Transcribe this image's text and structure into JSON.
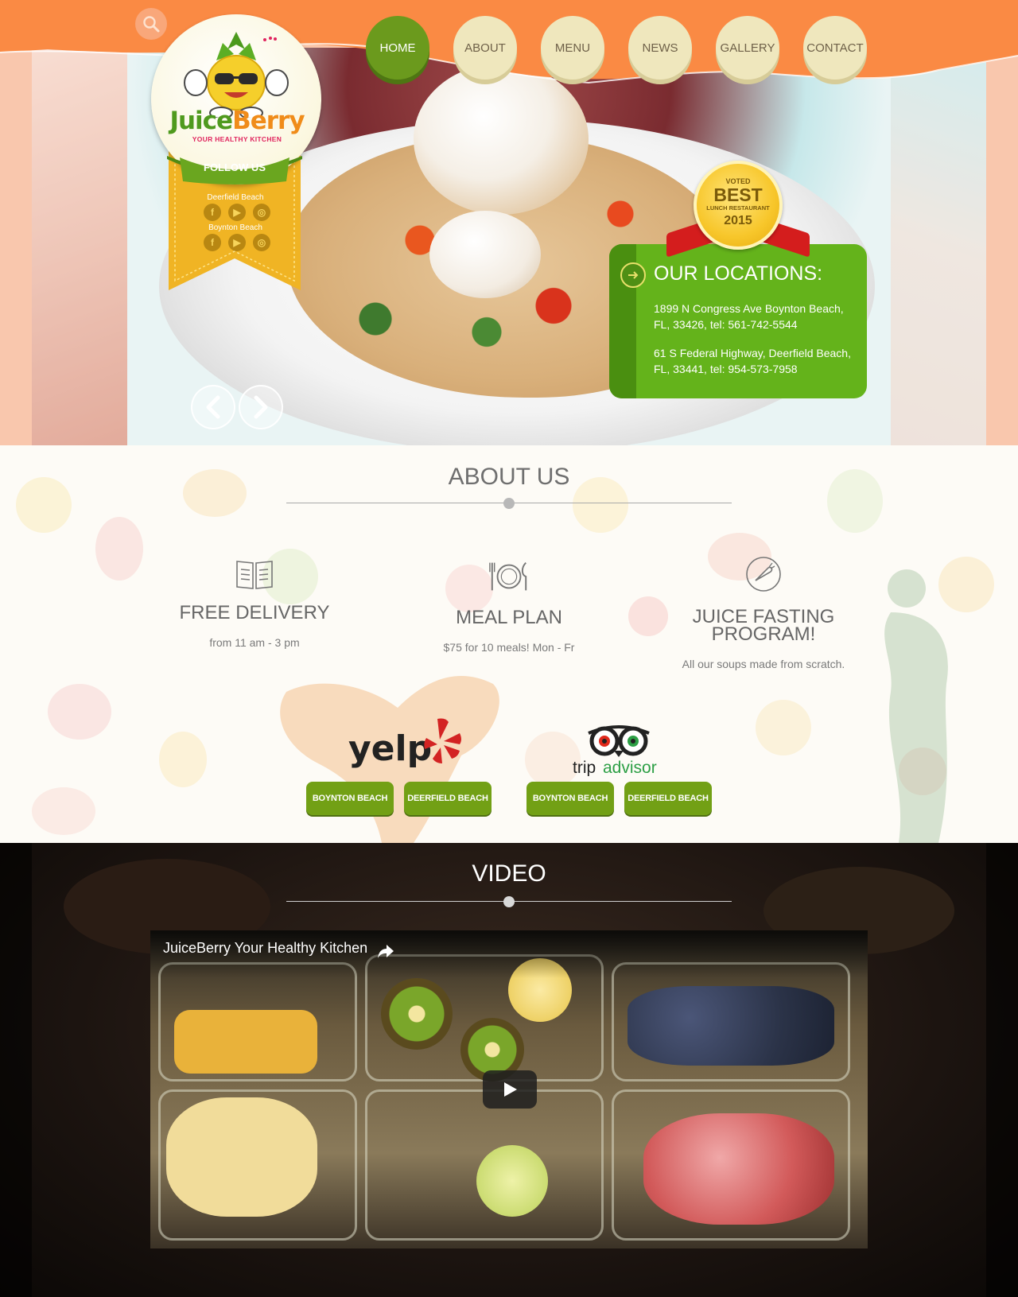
{
  "header": {
    "logo": {
      "name_part1": "Juice",
      "name_part2": "Berry",
      "tagline": "YOUR HEALTHY KITCHEN"
    },
    "follow_us": "FOLLOW US",
    "social_locations": [
      "Deerfield Beach",
      "Boynton Beach"
    ],
    "social_icons": [
      "facebook-icon",
      "youtube-icon",
      "instagram-icon"
    ],
    "nav": [
      "HOME",
      "ABOUT",
      "MENU",
      "NEWS",
      "GALLERY",
      "CONTACT"
    ],
    "active_nav": "HOME",
    "colors": {
      "orange": "#fa8a44",
      "green": "#6b9a1d",
      "cream": "#efe7bd"
    }
  },
  "hero": {
    "badge": {
      "voted": "VOTED",
      "best": "BEST",
      "subtitle": "LUNCH RESTAURANT",
      "year": "2015"
    },
    "locations": {
      "title": "OUR LOCATIONS:",
      "addresses": [
        "1899 N Congress Ave Boynton Beach, FL, 33426, tel: 561-742-5544",
        "61 S Federal Highway, Deerfield Beach, FL, 33441, tel: 954-573-7958"
      ]
    },
    "arrows": [
      "prev",
      "next"
    ]
  },
  "about": {
    "title": "ABOUT US",
    "features": [
      {
        "icon": "book-icon",
        "title": "FREE DELIVERY",
        "subtitle": "from 11 am - 3 pm"
      },
      {
        "icon": "plate-icon",
        "title": "MEAL PLAN",
        "subtitle": "$75 for 10 meals! Mon - Fr"
      },
      {
        "icon": "carrot-icon",
        "title": "JUICE FASTING PROGRAM!",
        "subtitle": "All our soups made from scratch."
      }
    ],
    "reviews": {
      "yelp": {
        "logo_text": "yelp",
        "buttons": [
          "BOYNTON BEACH",
          "DEERFIELD BEACH"
        ]
      },
      "tripadvisor": {
        "logo_text_a": "trip",
        "logo_text_b": "advisor",
        "buttons": [
          "BOYNTON BEACH",
          "DEERFIELD BEACH"
        ]
      }
    }
  },
  "video": {
    "title": "VIDEO",
    "player_title": "JuiceBerry Your Healthy Kitchen"
  }
}
